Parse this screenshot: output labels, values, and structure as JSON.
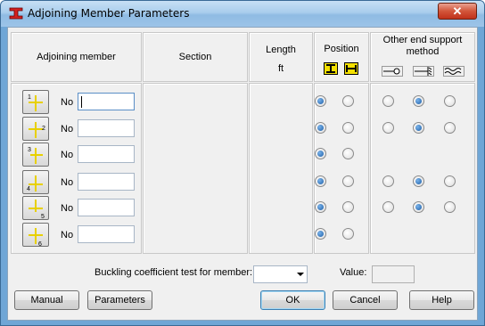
{
  "window": {
    "title": "Adjoining Member Parameters",
    "close_label": "✕"
  },
  "headers": {
    "adjoining_member": "Adjoining member",
    "section": "Section",
    "length": "Length",
    "length_unit": "ft",
    "position": "Position",
    "other_end_support_line1": "Other end support",
    "other_end_support_line2": "method"
  },
  "icons": {
    "position": [
      "i-beam-icon",
      "h-beam-icon"
    ],
    "support": [
      "pinned-support-icon",
      "fixed-support-icon",
      "elastic-support-icon"
    ]
  },
  "rows": [
    {
      "member_label": "1",
      "no_label": "No",
      "value": "",
      "position": [
        true,
        false
      ],
      "support": [
        false,
        true,
        false
      ],
      "show_support": true
    },
    {
      "member_label": "2",
      "no_label": "No",
      "value": "",
      "position": [
        true,
        false
      ],
      "support": [
        false,
        true,
        false
      ],
      "show_support": true
    },
    {
      "member_label": "3",
      "no_label": "No",
      "value": "",
      "position": [
        true,
        false
      ],
      "support": [],
      "show_support": false
    },
    {
      "member_label": "4",
      "no_label": "No",
      "value": "",
      "position": [
        true,
        false
      ],
      "support": [
        false,
        true,
        false
      ],
      "show_support": true
    },
    {
      "member_label": "5",
      "no_label": "No",
      "value": "",
      "position": [
        true,
        false
      ],
      "support": [
        false,
        true,
        false
      ],
      "show_support": true
    },
    {
      "member_label": "6",
      "no_label": "No",
      "value": "",
      "position": [
        true,
        false
      ],
      "support": [],
      "show_support": false
    }
  ],
  "buckling": {
    "label": "Buckling coefficient test for member:",
    "selected": ""
  },
  "value_label": "Value:",
  "value": "",
  "buttons": {
    "manual": "Manual",
    "parameters": "Parameters",
    "ok": "OK",
    "cancel": "Cancel",
    "help": "Help"
  },
  "colors": {
    "accent": "#1d5fa8",
    "member_line": "#e8d000"
  }
}
